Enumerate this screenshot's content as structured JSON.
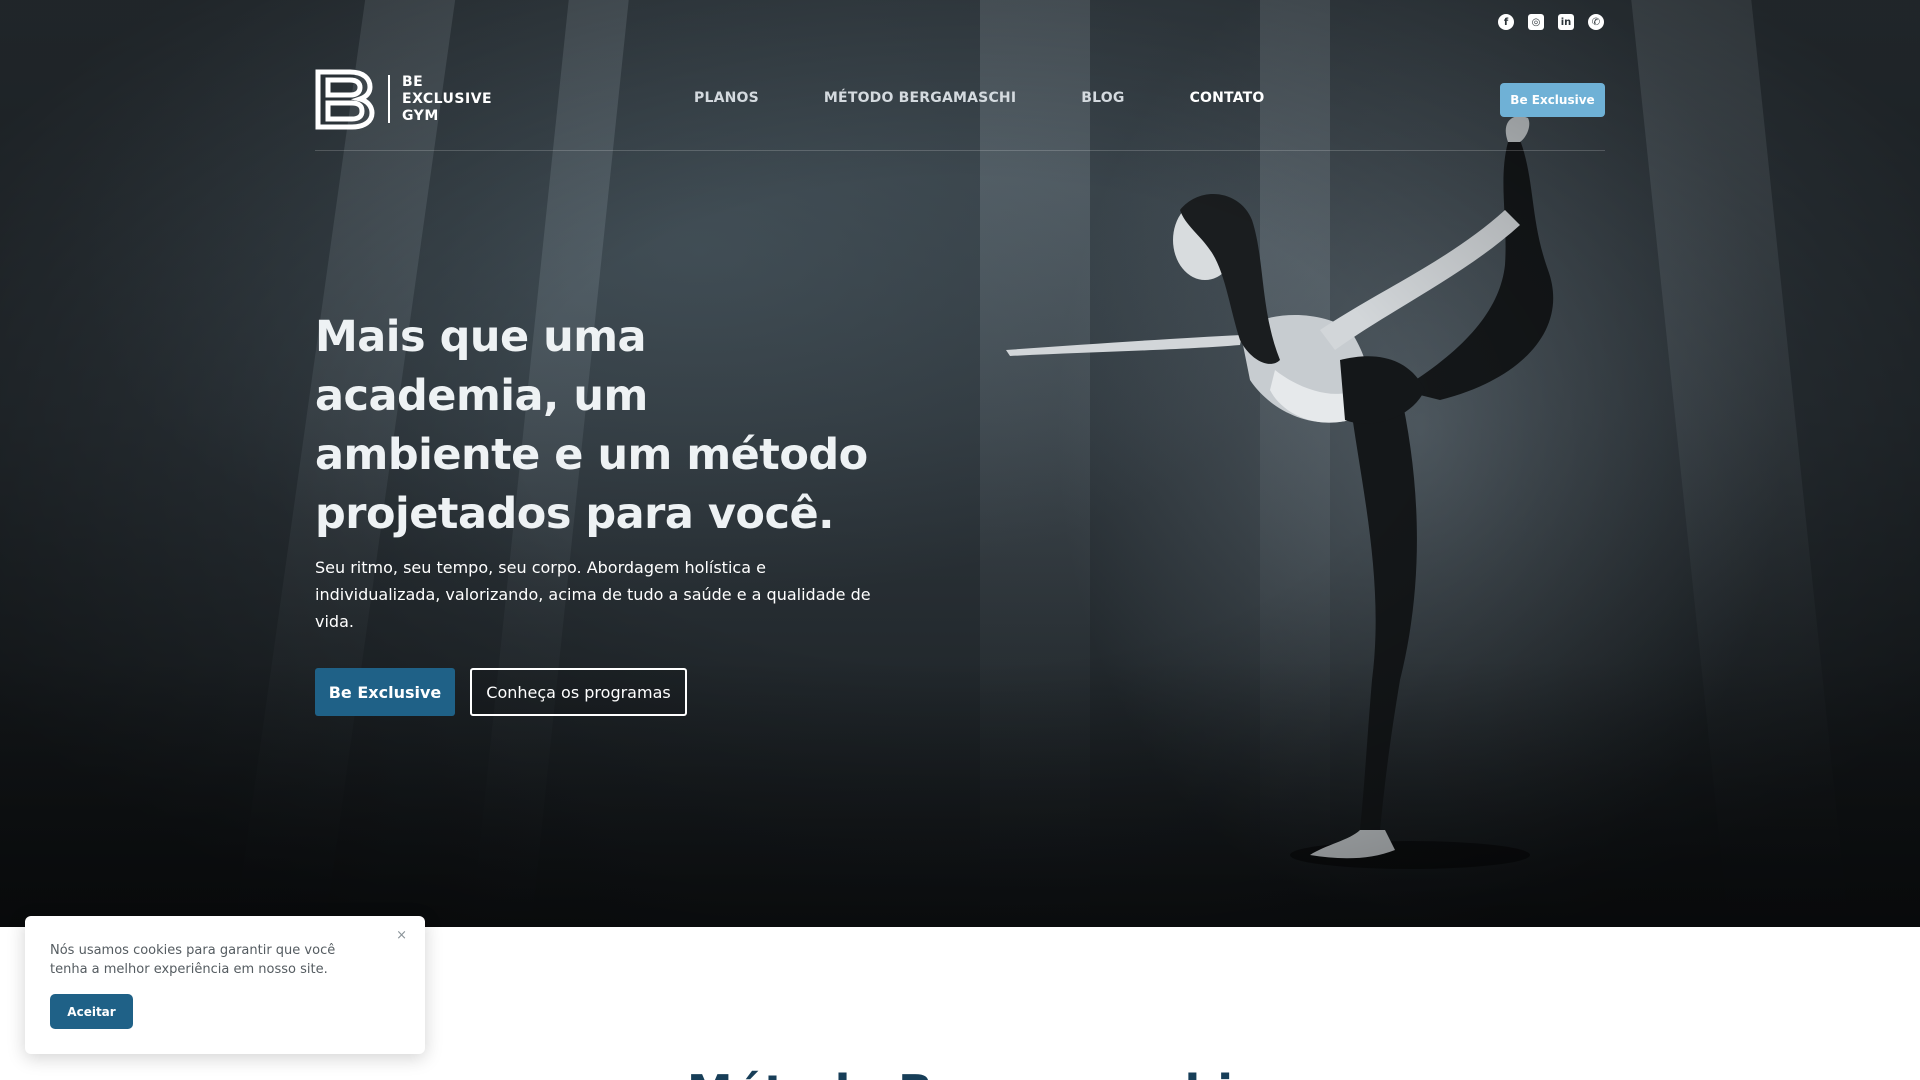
{
  "social": {
    "icons": [
      "facebook-icon",
      "instagram-icon",
      "linkedin-icon",
      "whatsapp-icon"
    ]
  },
  "brand": {
    "line1": "BE",
    "line2": "EXCLUSIVE",
    "line3": "GYM"
  },
  "nav": {
    "items": [
      {
        "label": "PLANOS"
      },
      {
        "label": "MÉTODO BERGAMASCHI"
      },
      {
        "label": "BLOG"
      },
      {
        "label": "CONTATO"
      }
    ],
    "cta_label": "Be Exclusive"
  },
  "hero": {
    "title": "Mais que uma academia, um ambiente e um método projetados para você.",
    "subtitle": "Seu ritmo, seu tempo, seu corpo. Abordagem holística e individualizada, valorizando, acima de tudo a saúde e a qualidade de vida.",
    "primary_label": "Be Exclusive",
    "secondary_label": "Conheça os programas"
  },
  "below": {
    "heading": "Método Bergamaschi"
  },
  "cookie": {
    "text": "Nós usamos cookies para garantir que você tenha a melhor experiência em nosso site.",
    "close": "×",
    "accept_label": "Aceitar"
  },
  "colors": {
    "accent": "#6fb1d6",
    "primary": "#1f6187",
    "heading_dark": "#173e58"
  }
}
